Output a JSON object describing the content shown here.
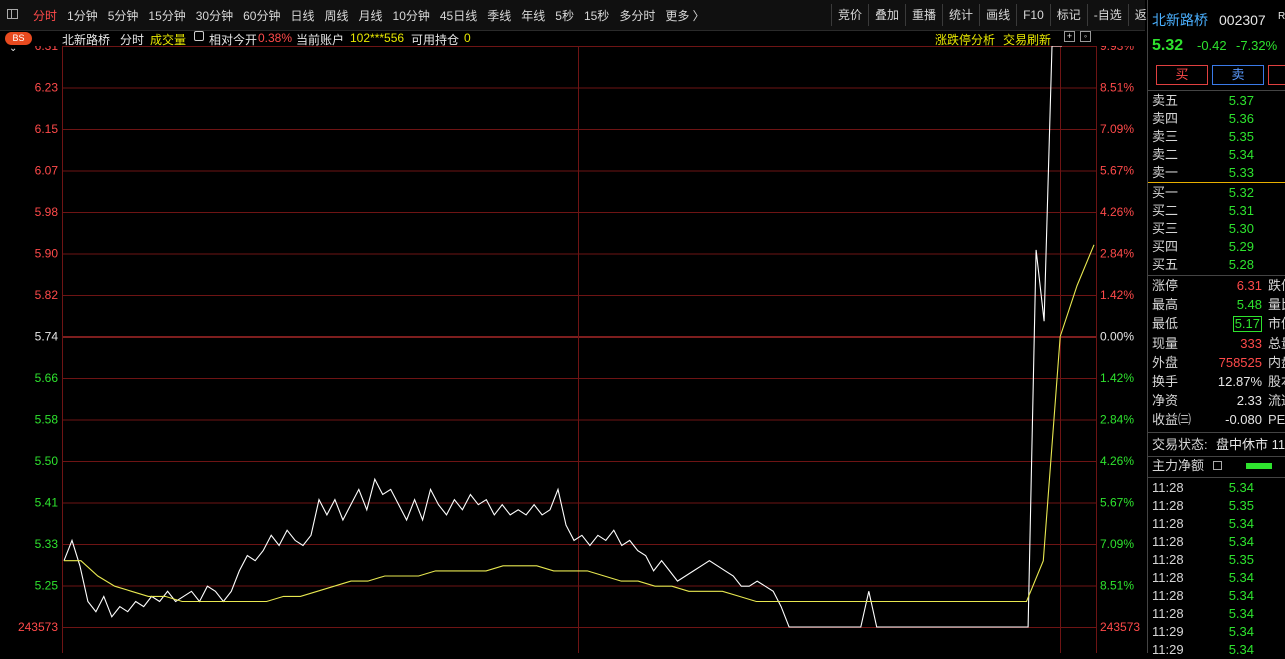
{
  "toolbar": {
    "periods": [
      "分时",
      "1分钟",
      "5分钟",
      "15分钟",
      "30分钟",
      "60分钟",
      "日线",
      "周线",
      "月线",
      "10分钟",
      "45日线",
      "季线",
      "年线",
      "5秒",
      "15秒",
      "多分时",
      "更多 〉"
    ],
    "active_period": "分时",
    "tools": [
      "竞价",
      "叠加",
      "重播",
      "统计",
      "画线",
      "F10",
      "标记",
      "-自选",
      "返回"
    ]
  },
  "info": {
    "badge": "BS",
    "name": "北新路桥",
    "mode": "分时",
    "indicator": "成交量",
    "relative_label": "相对今开",
    "relative_value": "0.38%",
    "account_label": "当前账户",
    "account_value": "102***556",
    "holding_label": "可用持仓",
    "holding_value": "0",
    "limit_analysis": "涨跌停分析",
    "refresh": "交易刷新"
  },
  "chart_data": {
    "type": "line",
    "prices_left_axis": [
      "6.31",
      "6.23",
      "6.15",
      "6.07",
      "5.98",
      "5.90",
      "5.82",
      "5.74",
      "5.66",
      "5.58",
      "5.50",
      "5.41",
      "5.33",
      "5.25",
      "243573"
    ],
    "percent_right_axis": [
      "9.93%",
      "8.51%",
      "7.09%",
      "5.67%",
      "4.26%",
      "2.84%",
      "1.42%",
      "0.00%",
      "1.42%",
      "2.84%",
      "4.26%",
      "5.67%",
      "7.09%",
      "8.51%",
      "243573"
    ],
    "prev_close": 5.74,
    "ylim": [
      5.17,
      6.31
    ],
    "series": [
      {
        "color": "#ffffff",
        "values": [
          5.3,
          5.34,
          5.29,
          5.22,
          5.2,
          5.23,
          5.19,
          5.21,
          5.2,
          5.22,
          5.21,
          5.23,
          5.22,
          5.24,
          5.22,
          5.23,
          5.24,
          5.22,
          5.25,
          5.24,
          5.22,
          5.24,
          5.28,
          5.31,
          5.3,
          5.32,
          5.35,
          5.33,
          5.36,
          5.34,
          5.33,
          5.35,
          5.42,
          5.39,
          5.42,
          5.38,
          5.41,
          5.44,
          5.4,
          5.46,
          5.43,
          5.44,
          5.41,
          5.38,
          5.42,
          5.38,
          5.44,
          5.41,
          5.39,
          5.42,
          5.4,
          5.43,
          5.41,
          5.42,
          5.39,
          5.41,
          5.39,
          5.4,
          5.39,
          5.41,
          5.39,
          5.4,
          5.44,
          5.37,
          5.34,
          5.35,
          5.33,
          5.35,
          5.34,
          5.36,
          5.33,
          5.34,
          5.32,
          5.31,
          5.28,
          5.3,
          5.28,
          5.26,
          5.27,
          5.28,
          5.29,
          5.3,
          5.29,
          5.28,
          5.27,
          5.25,
          5.25,
          5.26,
          5.25,
          5.24,
          5.21,
          5.17,
          5.17,
          5.17,
          5.17,
          5.17,
          5.17,
          5.17,
          5.17,
          5.17,
          5.17,
          5.24,
          5.17,
          5.17,
          5.17,
          5.17,
          5.17,
          5.17,
          5.17,
          5.17,
          5.17,
          5.17,
          5.17,
          5.17,
          5.17,
          5.17,
          5.17,
          5.17,
          5.17,
          5.17,
          5.17,
          5.17,
          5.91,
          5.77,
          6.31,
          6.31
        ]
      },
      {
        "color": "#e8e850",
        "values": [
          5.3,
          5.3,
          5.27,
          5.25,
          5.24,
          5.23,
          5.23,
          5.22,
          5.22,
          5.22,
          5.22,
          5.22,
          5.22,
          5.23,
          5.23,
          5.24,
          5.25,
          5.26,
          5.26,
          5.27,
          5.27,
          5.27,
          5.28,
          5.28,
          5.28,
          5.28,
          5.29,
          5.29,
          5.29,
          5.28,
          5.28,
          5.28,
          5.27,
          5.26,
          5.26,
          5.25,
          5.25,
          5.24,
          5.24,
          5.24,
          5.23,
          5.22,
          5.22,
          5.22,
          5.22,
          5.22,
          5.22,
          5.22,
          5.22,
          5.22,
          5.22,
          5.22,
          5.22,
          5.22,
          5.22,
          5.22,
          5.22,
          5.22,
          5.3,
          5.74,
          5.84,
          5.92
        ]
      }
    ]
  },
  "panel": {
    "name": "北新路桥",
    "code": "002307",
    "code_suffix": "R",
    "price": "5.32",
    "change": "-0.42",
    "change_pct": "-7.32%",
    "buy_label": "买",
    "sell_label": "卖",
    "asks": [
      {
        "label": "卖五",
        "price": "5.37"
      },
      {
        "label": "卖四",
        "price": "5.36"
      },
      {
        "label": "卖三",
        "price": "5.35"
      },
      {
        "label": "卖二",
        "price": "5.34"
      },
      {
        "label": "卖一",
        "price": "5.33"
      }
    ],
    "bids": [
      {
        "label": "买一",
        "price": "5.32"
      },
      {
        "label": "买二",
        "price": "5.31"
      },
      {
        "label": "买三",
        "price": "5.30"
      },
      {
        "label": "买四",
        "price": "5.29"
      },
      {
        "label": "买五",
        "price": "5.28"
      }
    ],
    "stats": [
      {
        "label": "涨停",
        "value": "6.31",
        "extra": "跌停",
        "color": "#ff4a4a"
      },
      {
        "label": "最高",
        "value": "5.48",
        "extra": "量比",
        "color": "#2ee32e"
      },
      {
        "label": "最低",
        "value": "5.17",
        "extra": "市值",
        "color": "#2ee32e"
      },
      {
        "label": "现量",
        "value": "333",
        "extra": "总量",
        "color": "#ff4a4a"
      },
      {
        "label": "外盘",
        "value": "758525",
        "extra": "内盘",
        "color": "#ff4a4a"
      },
      {
        "label": "换手",
        "value": "12.87%",
        "extra": "股本",
        "color": "#e6e6e6"
      },
      {
        "label": "净资",
        "value": "2.33",
        "extra": "流通",
        "color": "#e6e6e6"
      },
      {
        "label": "收益㈢",
        "value": "-0.080",
        "extra": "PE",
        "color": "#e6e6e6"
      }
    ],
    "status_label": "交易状态:",
    "status_value": "盘中休市 11",
    "capital_label": "主力净额",
    "ticks": [
      {
        "time": "11:28",
        "price": "5.34"
      },
      {
        "time": "11:28",
        "price": "5.35"
      },
      {
        "time": "11:28",
        "price": "5.34"
      },
      {
        "time": "11:28",
        "price": "5.34"
      },
      {
        "time": "11:28",
        "price": "5.35"
      },
      {
        "time": "11:28",
        "price": "5.34"
      },
      {
        "time": "11:28",
        "price": "5.34"
      },
      {
        "time": "11:28",
        "price": "5.34"
      },
      {
        "time": "11:29",
        "price": "5.34"
      },
      {
        "time": "11:29",
        "price": "5.34"
      }
    ]
  }
}
